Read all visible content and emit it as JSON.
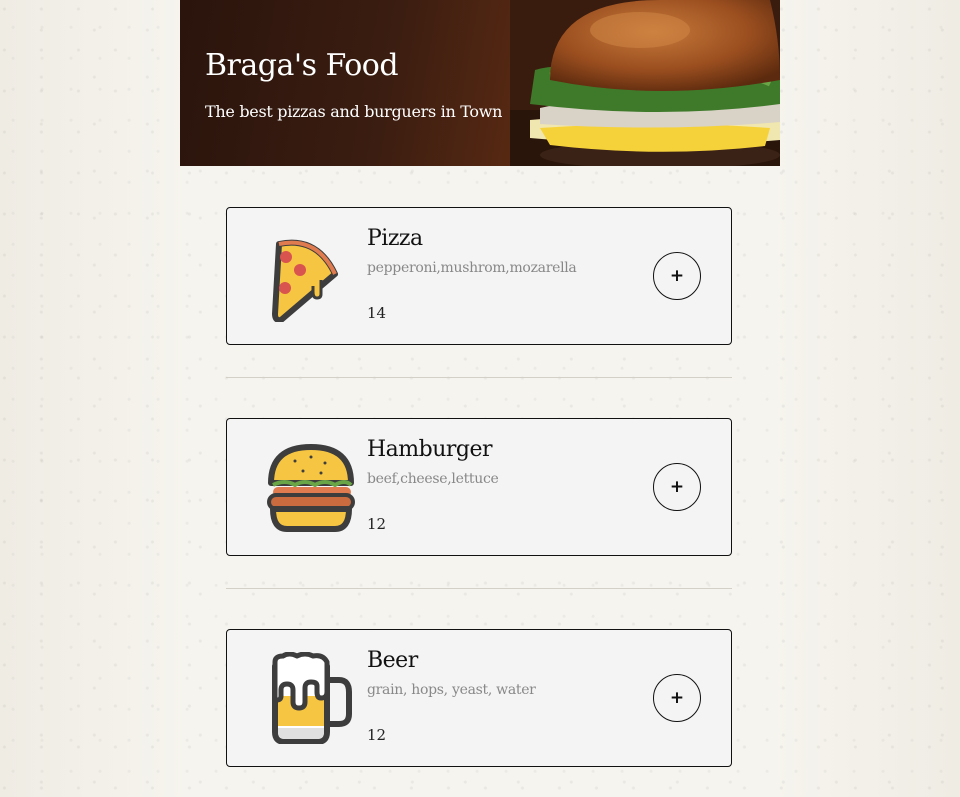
{
  "header": {
    "title": "Braga's Food",
    "subtitle": "The best pizzas and burguers in Town"
  },
  "menu": {
    "items": [
      {
        "name": "Pizza",
        "description": "pepperoni,mushrom,mozarella",
        "price": "14",
        "icon": "pizza-slice-icon",
        "button_label": "+"
      },
      {
        "name": "Hamburger",
        "description": "beef,cheese,lettuce",
        "price": "12",
        "icon": "hamburger-icon",
        "button_label": "+"
      },
      {
        "name": "Beer",
        "description": "grain, hops, yeast, water",
        "price": "12",
        "icon": "beer-mug-icon",
        "button_label": "+"
      }
    ]
  },
  "colors": {
    "card_background": "#f4f4f4",
    "border": "#111111",
    "muted_text": "#888888"
  }
}
